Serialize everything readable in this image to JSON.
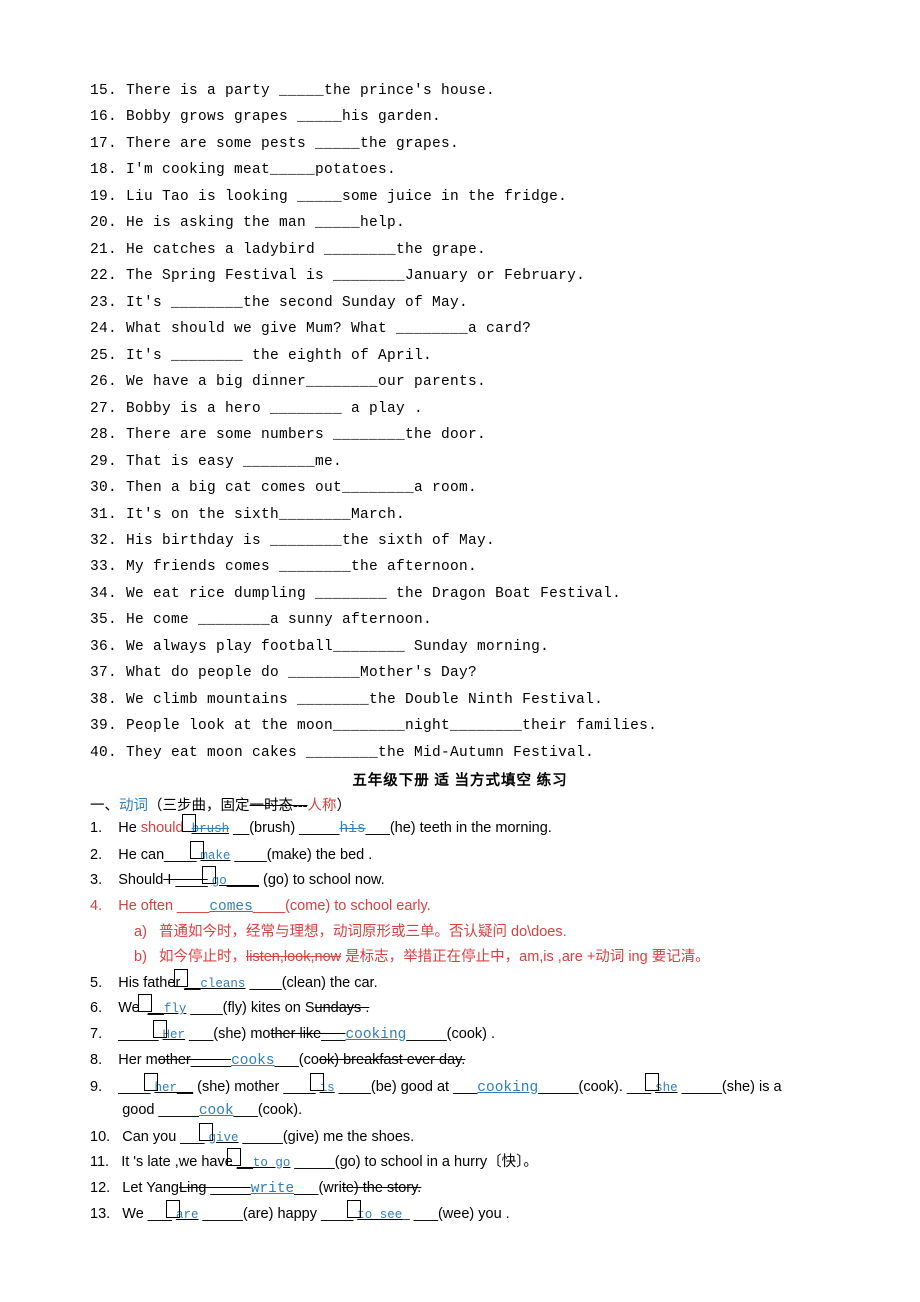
{
  "top": [
    {
      "n": "15.",
      "t": "There is a party _____the prince's house."
    },
    {
      "n": "16.",
      "t": "Bobby grows grapes _____his garden."
    },
    {
      "n": "17.",
      "t": "There are some pests _____the grapes."
    },
    {
      "n": "18.",
      "t": "I'm cooking meat_____potatoes."
    },
    {
      "n": "19.",
      "t": "Liu Tao is looking _____some juice in the fridge."
    },
    {
      "n": "20.",
      "t": "He is asking the man _____help."
    },
    {
      "n": "21.",
      "t": "He catches a ladybird ________the grape."
    },
    {
      "n": "22.",
      "t": "The Spring Festival is  ________January or February."
    },
    {
      "n": "23.",
      "t": "It's  ________the second Sunday of May."
    },
    {
      "n": "24.",
      "t": "What should we give Mum? What  ________a card?"
    },
    {
      "n": "25.",
      "t": "It's  ________ the eighth of April."
    },
    {
      "n": "26.",
      "t": "We have a big dinner________our parents."
    },
    {
      "n": "27.",
      "t": "Bobby is a hero ________ a play ."
    },
    {
      "n": "28.",
      "t": "There are some numbers  ________the door."
    },
    {
      "n": "29.",
      "t": "That is easy ________me."
    },
    {
      "n": "30.",
      "t": "Then a big cat comes out________a room."
    },
    {
      "n": "31.",
      "t": "It's on the sixth________March."
    },
    {
      "n": "32.",
      "t": "His birthday is  ________the sixth of May."
    },
    {
      "n": "33.",
      "t": "My friends comes ________the afternoon."
    },
    {
      "n": "34.",
      "t": "We eat rice dumpling  ________ the Dragon Boat Festival."
    },
    {
      "n": "35.",
      "t": "He come  ________a sunny afternoon."
    },
    {
      "n": "36.",
      "t": "We always play football________ Sunday morning."
    },
    {
      "n": "37.",
      "t": "What do people do  ________Mother's Day?"
    },
    {
      "n": "38.",
      "t": "We climb mountains  ________the Double Ninth Festival."
    },
    {
      "n": "39.",
      "t": "People look at the moon________night________their families."
    },
    {
      "n": "40.",
      "t": "They eat moon cakes  ________the Mid-Autumn Festival."
    }
  ],
  "title": "五年级下册  适 当方式填空 练习",
  "head_pre": "一、",
  "head_blue": "动词",
  "head_mid": "（三步曲，固定",
  "head_strike": "一时态---",
  "head_red": "人称",
  "head_post": "）",
  "b": {
    "q1_n": "1.",
    "q1_a": "He ",
    "q1_should": "should ",
    "q1_fill": "brush",
    "q1_b": "(brush) _____",
    "q1_his": "his",
    "q1_c": "(he) teeth in the morning.",
    "q2_n": "2.",
    "q2_a": "He can____",
    "q2_fill": "make",
    "q2_b": "____(make) the bed .",
    "q3_n": "3.",
    "q3_a": "Should",
    "q3_strike": " I ____",
    "q3_fill": "go",
    "q3_b": "(go) to school now.",
    "q4_n": "4.",
    "q4_a": "He often ____",
    "q4_fill": "comes",
    "q4_b": "____(come) to school early.",
    "q4a_n": "a)",
    "q4a": "普通如今时，经常与理想，动词原形或三单。否认疑问 do\\does.",
    "q4b_n": "b)",
    "q4b_a": "如今停止时，",
    "q4b_s": "listen,look,now",
    "q4b_b": " 是标志，举措正在停止中，am,is ,are +动词 ing  要记清。",
    "q5_n": "5.",
    "q5_a": "His father",
    "q5_fill": "cleans",
    "q5_b": "____(clean) the car.",
    "q6_n": "6.",
    "q6_a": "We   ",
    "q6_fill": "fly",
    "q6_b": "____(fly) kites on S",
    "q6_s": "undays .",
    "q7_n": "7.",
    "q7_a": "_____",
    "q7_fill1": "Her",
    "q7_b": "___(she) mo",
    "q7_s": "ther like___",
    "q7_fill2": "cooking",
    "q7_c": "_____(cook) .",
    "q8_n": "8.",
    "q8_a": "Her m",
    "q8_s1": "other_____",
    "q8_fill": "cooks",
    "q8_b": "___(co",
    "q8_s2": "ok) breakfast ever day.",
    "q9_n": "9.",
    "q9_fill1": "her",
    "q9_a": "(she) mother ____",
    "q9_fill2": "is",
    "q9_b": "____(be) good at ___",
    "q9_fill3": "cooking",
    "q9_c": "_____(cook). ___",
    "q9_fill4": "she",
    "q9_d": "_____(she) is a",
    "q9_e": "good _____",
    "q9_fill5": "cook",
    "q9_f": "___(cook).",
    "q10_n": "10.",
    "q10_a": "Can   you ___",
    "q10_fill": "give",
    "q10_b": "_____(give) me the shoes.",
    "q11_n": "11.",
    "q11_a": "It 's late ,we have",
    "q11_fill": "to go",
    "q11_b": "_____(go) to school in a hurry〔快〕。",
    "q12_n": "12.",
    "q12_a": "Let Yang",
    "q12_s": "Ling _____",
    "q12_fill": "write",
    "q12_b": "___(wri",
    "q12_s2": "te) the story.",
    "q13_n": "13.",
    "q13_a": "We ___",
    "q13_fill1": "are",
    "q13_b": "_____(are) happy ____",
    "q13_fill2": "to see_",
    "q13_c": "___(wee) you ."
  }
}
